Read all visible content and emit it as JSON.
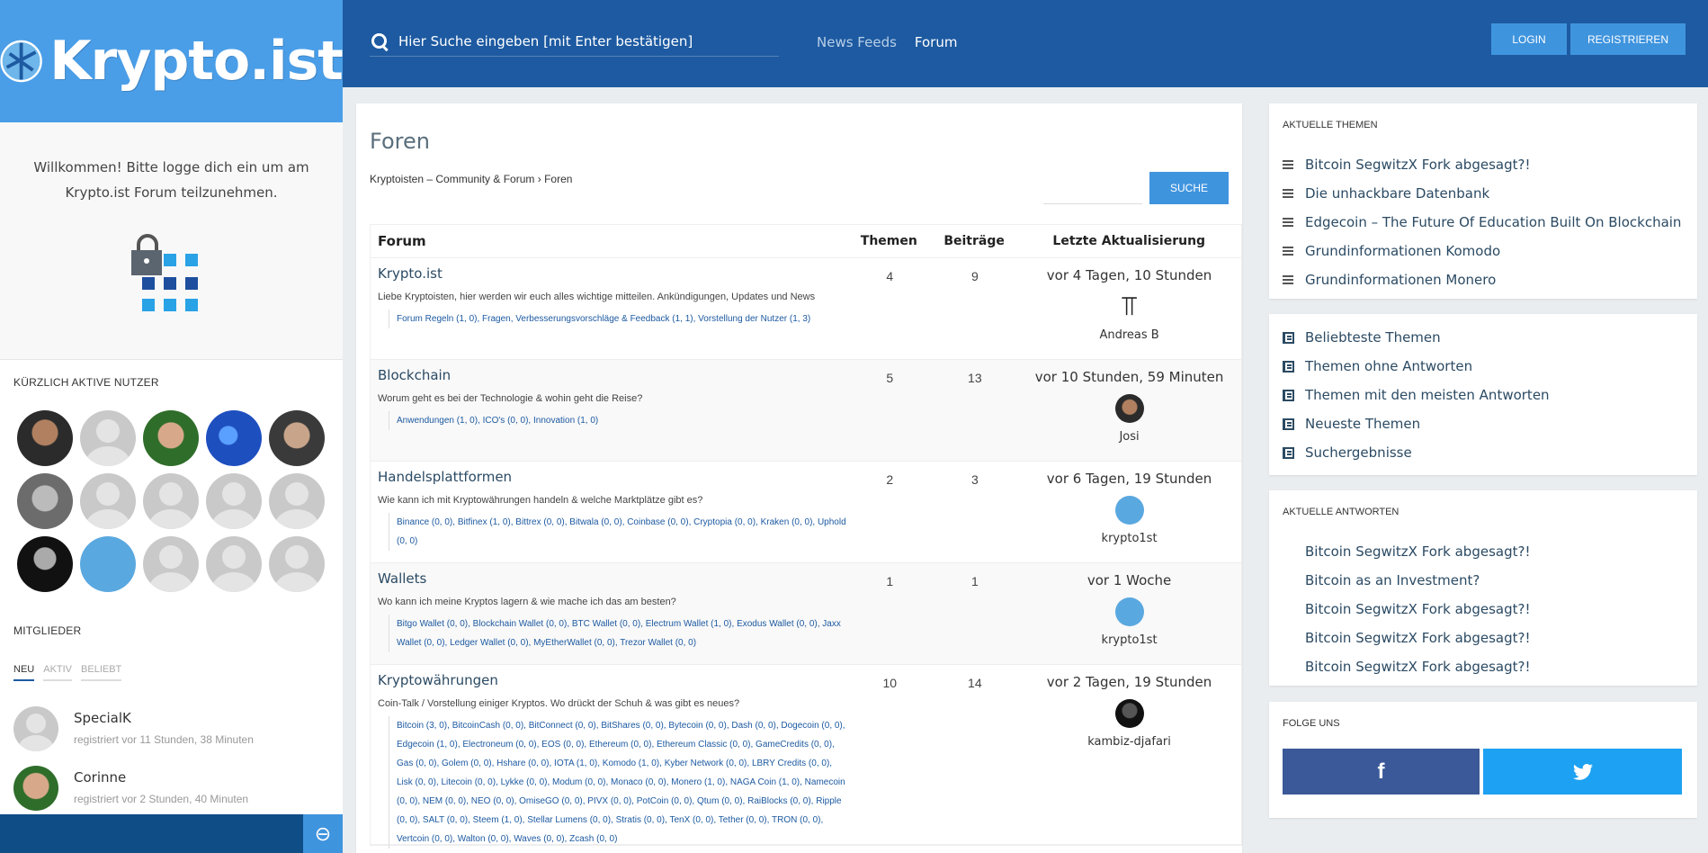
{
  "brand": {
    "logo_text": "Krypto.ist"
  },
  "sidebar": {
    "welcome": "Willkommen! Bitte logge dich ein um am Krypto.ist Forum teilzunehmen.",
    "active_users_heading": "KÜRZLICH AKTIVE NUTZER",
    "members_heading": "MITGLIEDER",
    "member_tabs": [
      "NEU",
      "AKTIV",
      "BELIEBT"
    ],
    "members": [
      {
        "name": "SpecialK",
        "meta": "registriert vor 11 Stunden, 38 Minuten"
      },
      {
        "name": "Corinne",
        "meta": "registriert vor 2 Stunden, 40 Minuten"
      }
    ]
  },
  "header": {
    "search_placeholder": "Hier Suche eingeben [mit Enter bestätigen]",
    "nav": [
      "News Feeds",
      "Forum"
    ],
    "login": "LOGIN",
    "register": "REGISTRIEREN"
  },
  "main": {
    "title": "Foren",
    "breadcrumb": {
      "community": "Kryptoisten – Community & Forum",
      "sep": "›",
      "current": "Foren"
    },
    "search_button": "SUCHE",
    "columns": {
      "forum": "Forum",
      "topics": "Themen",
      "posts": "Beiträge",
      "last": "Letzte Aktualisierung"
    },
    "forums": [
      {
        "title": "Krypto.ist",
        "desc": "Liebe Kryptoisten, hier werden wir euch alles wichtige mitteilen. Ankündigungen, Updates und News",
        "subs": "Forum Regeln (1, 0), Fragen, Verbesserungsvorschläge & Feedback (1, 1), Vorstellung der Nutzer (1, 3)",
        "topics": "4",
        "posts": "9",
        "last": "vor 4 Tagen, 10 Stunden",
        "user": "Andreas B",
        "avatar": "glyph"
      },
      {
        "title": "Blockchain",
        "desc": "Worum geht es bei der Technologie & wohin geht die Reise?",
        "subs": "Anwendungen (1, 0), ICO's (0, 0), Innovation (1, 0)",
        "topics": "5",
        "posts": "13",
        "last": "vor 10 Stunden, 59 Minuten",
        "user": "Josi",
        "avatar": "photo"
      },
      {
        "title": "Handelsplattformen",
        "desc": "Wie kann ich mit Kryptowährungen handeln & welche Marktplätze gibt es?",
        "subs": "Binance (0, 0), Bitfinex (1, 0), Bittrex (0, 0), Bitwala (0, 0), Coinbase (0, 0), Cryptopia (0, 0), Kraken (0, 0), Uphold (0, 0)",
        "topics": "2",
        "posts": "3",
        "last": "vor 6 Tagen, 19 Stunden",
        "user": "krypto1st",
        "avatar": "logo"
      },
      {
        "title": "Wallets",
        "desc": "Wo kann ich meine Kryptos lagern & wie mache ich das am besten?",
        "subs": "Bitgo Wallet (0, 0), Blockchain Wallet (0, 0), BTC Wallet (0, 0), Electrum Wallet (1, 0), Exodus Wallet (0, 0), Jaxx Wallet (0, 0), Ledger Wallet (0, 0), MyEtherWallet (0, 0), Trezor Wallet (0, 0)",
        "topics": "1",
        "posts": "1",
        "last": "vor 1 Woche",
        "user": "krypto1st",
        "avatar": "logo"
      },
      {
        "title": "Kryptowährungen",
        "desc": "Coin-Talk / Vorstellung einiger Kryptos. Wo drückt der Schuh & was gibt es neues?",
        "subs": "Bitcoin (3, 0), BitcoinCash (0, 0), BitConnect (0, 0), BitShares (0, 0), Bytecoin (0, 0), Dash (0, 0), Dogecoin (0, 0), Edgecoin (1, 0), Electroneum (0, 0), EOS (0, 0), Ethereum (0, 0), Ethereum Classic (0, 0), GameCredits (0, 0), Gas (0, 0), Golem (0, 0), Hshare (0, 0), IOTA (1, 0), Komodo (1, 0), Kyber Network (0, 0), LBRY Credits (0, 0), Lisk (0, 0), Litecoin (0, 0), Lykke (0, 0), Modum (0, 0), Monaco (0, 0), Monero (1, 0), NAGA Coin (1, 0), Namecoin (0, 0), NEM (0, 0), NEO (0, 0), OmiseGO (0, 0), PIVX (0, 0), PotCoin (0, 0), Qtum (0, 0), RaiBlocks (0, 0), Ripple (0, 0), SALT (0, 0), Steem (1, 0), Stellar Lumens (0, 0), Stratis (0, 0), TenX (0, 0), Tether (0, 0), TRON (0, 0), Vertcoin (0, 0), Walton (0, 0), Waves (0, 0), Zcash (0, 0)",
        "topics": "10",
        "posts": "14",
        "last": "vor 2 Tagen, 19 Stunden",
        "user": "kambiz-djafari",
        "avatar": "photo"
      }
    ]
  },
  "right": {
    "current_topics_heading": "AKTUELLE THEMEN",
    "current_topics": [
      "Bitcoin SegwitzX Fork abgesagt?!",
      "Die unhackbare Datenbank",
      "Edgecoin – The Future Of Education Built On Blockchain",
      "Grundinformationen Komodo",
      "Grundinformationen Monero"
    ],
    "views": [
      "Beliebteste Themen",
      "Themen ohne Antworten",
      "Themen mit den meisten Antworten",
      "Neueste Themen",
      "Suchergebnisse"
    ],
    "current_replies_heading": "AKTUELLE ANTWORTEN",
    "current_replies": [
      "Bitcoin SegwitzX Fork abgesagt?!",
      "Bitcoin as an Investment?",
      "Bitcoin SegwitzX Fork abgesagt?!",
      "Bitcoin SegwitzX Fork abgesagt?!",
      "Bitcoin SegwitzX Fork abgesagt?!"
    ],
    "follow_heading": "FOLGE UNS",
    "facebook_glyph": "f",
    "twitter_glyph": "t"
  },
  "colors": {
    "header": "#1d5aa1",
    "accent": "#3f94de",
    "logo_bg": "#4a9ee8",
    "facebook": "#3b5998",
    "twitter": "#1da1f2"
  }
}
